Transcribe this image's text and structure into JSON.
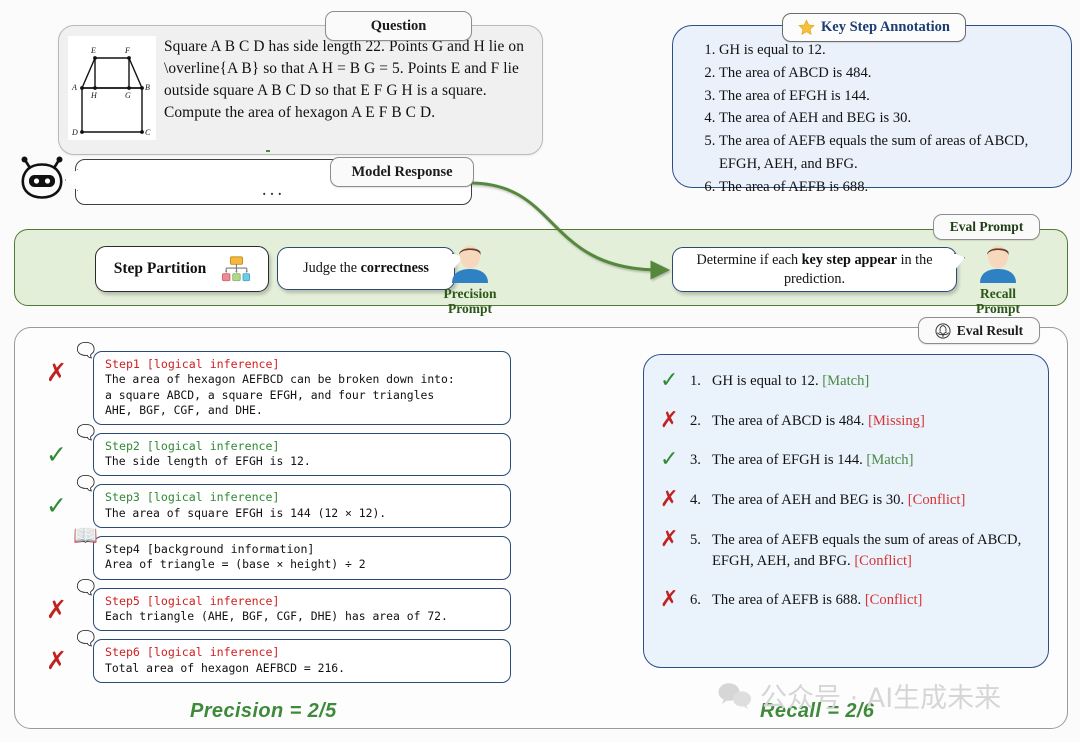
{
  "question": {
    "tag": "Question",
    "text": "Square A B C D has side length 22. Points G and H lie on \\overline{A B} so that A H = B G = 5. Points E and F lie outside square A B C D so that E F G H is a square. Compute the area of hexagon A E F B C D.",
    "figure_labels": [
      "E",
      "F",
      "A",
      "H",
      "G",
      "B",
      "D",
      "C"
    ]
  },
  "key_step_annotation": {
    "tag": "Key Step Annotation",
    "icon": "star-icon",
    "items": [
      "GH is equal to 12.",
      "The area of ABCD is 484.",
      "The area of EFGH is 144.",
      "The area of AEH and BEG is 30.",
      "The area of AEFB equals the sum of areas of ABCD, EFGH, AEH, and BFG.",
      "The area of AEFB is 688."
    ]
  },
  "model_response": {
    "tag": "Model Response",
    "body": "...",
    "icon": "robot-icon"
  },
  "eval_prompt": {
    "tag": "Eval Prompt",
    "step_partition_label": "Step Partition",
    "step_partition_icon": "hierarchy-icon",
    "precision_prompt_text_plain": "Judge the correctness",
    "precision_prompt_prefix": "Judge the ",
    "precision_prompt_bold": "correctness",
    "precision_avatar_label": "Precision\nPrompt",
    "precision_avatar_line1": "Precision",
    "precision_avatar_line2": "Prompt",
    "recall_prompt_prefix": "Determine if each ",
    "recall_prompt_bold": "key step appear",
    "recall_prompt_suffix": " in the prediction.",
    "recall_avatar_line1": "Recall",
    "recall_avatar_line2": "Prompt"
  },
  "eval_result": {
    "tag": "Eval Result",
    "icon": "openai-icon",
    "steps": [
      {
        "mark": "✗",
        "mark_type": "x",
        "emoji": "thought-bubble-icon",
        "head": "Step1 [logical inference]",
        "head_color": "red",
        "body": "The area of hexagon AEFBCD can be broken down into:\na square ABCD, a square EFGH, and four triangles\nAHE, BGF, CGF, and DHE."
      },
      {
        "mark": "✓",
        "mark_type": "v",
        "emoji": "thought-bubble-icon",
        "head": "Step2 [logical inference]",
        "head_color": "green",
        "body": "The side length of EFGH is 12."
      },
      {
        "mark": "✓",
        "mark_type": "v",
        "emoji": "thought-bubble-icon",
        "head": "Step3 [logical inference]",
        "head_color": "green",
        "body": "The area of square EFGH is 144 (12 × 12)."
      },
      {
        "mark": "",
        "mark_type": "none",
        "emoji": "open-book-icon",
        "head": "Step4 [background information]",
        "head_color": "black",
        "body": "Area of triangle = (base × height) ÷ 2"
      },
      {
        "mark": "✗",
        "mark_type": "x",
        "emoji": "thought-bubble-icon",
        "head": "Step5 [logical inference]",
        "head_color": "red",
        "body": "Each triangle (AHE, BGF, CGF, DHE) has area of 72."
      },
      {
        "mark": "✗",
        "mark_type": "x",
        "emoji": "thought-bubble-icon",
        "head": "Step6 [logical inference]",
        "head_color": "red",
        "body": "Total area of hexagon AEFBCD = 216."
      }
    ],
    "recall_items": [
      {
        "mark": "✓",
        "mark_type": "v",
        "num": "1.",
        "text": "GH is equal to 12.",
        "status": "[Match]",
        "status_type": "match"
      },
      {
        "mark": "✗",
        "mark_type": "x",
        "num": "2.",
        "text": "The area of ABCD is 484.",
        "status": "[Missing]",
        "status_type": "miss"
      },
      {
        "mark": "✓",
        "mark_type": "v",
        "num": "3.",
        "text": "The area of EFGH is 144.",
        "status": "[Match]",
        "status_type": "match"
      },
      {
        "mark": "✗",
        "mark_type": "x",
        "num": "4.",
        "text": "The area of AEH and BEG is 30.",
        "status": "[Conflict]",
        "status_type": "conf"
      },
      {
        "mark": "✗",
        "mark_type": "x",
        "num": "5.",
        "text": "The area of AEFB equals the sum of areas of ABCD, EFGH, AEH, and BFG.",
        "status": "[Conflict]",
        "status_type": "conf"
      },
      {
        "mark": "✗",
        "mark_type": "x",
        "num": "6.",
        "text": "The area of AEFB is 688.",
        "status": "[Conflict]",
        "status_type": "conf"
      }
    ],
    "precision_metric": "Precision = 2/5",
    "recall_metric": "Recall = 2/6"
  },
  "watermark": {
    "text": "公众号 · AI生成未来",
    "icon": "wechat-icon"
  },
  "colors": {
    "green_band": "#e4efd9",
    "green_border": "#4e7a34",
    "blue_panel": "#eaf1fb",
    "blue_border": "#2d4f89",
    "red": "#c0231f",
    "green_mark": "#2f8a34",
    "metric_green": "#3f8a3a"
  }
}
